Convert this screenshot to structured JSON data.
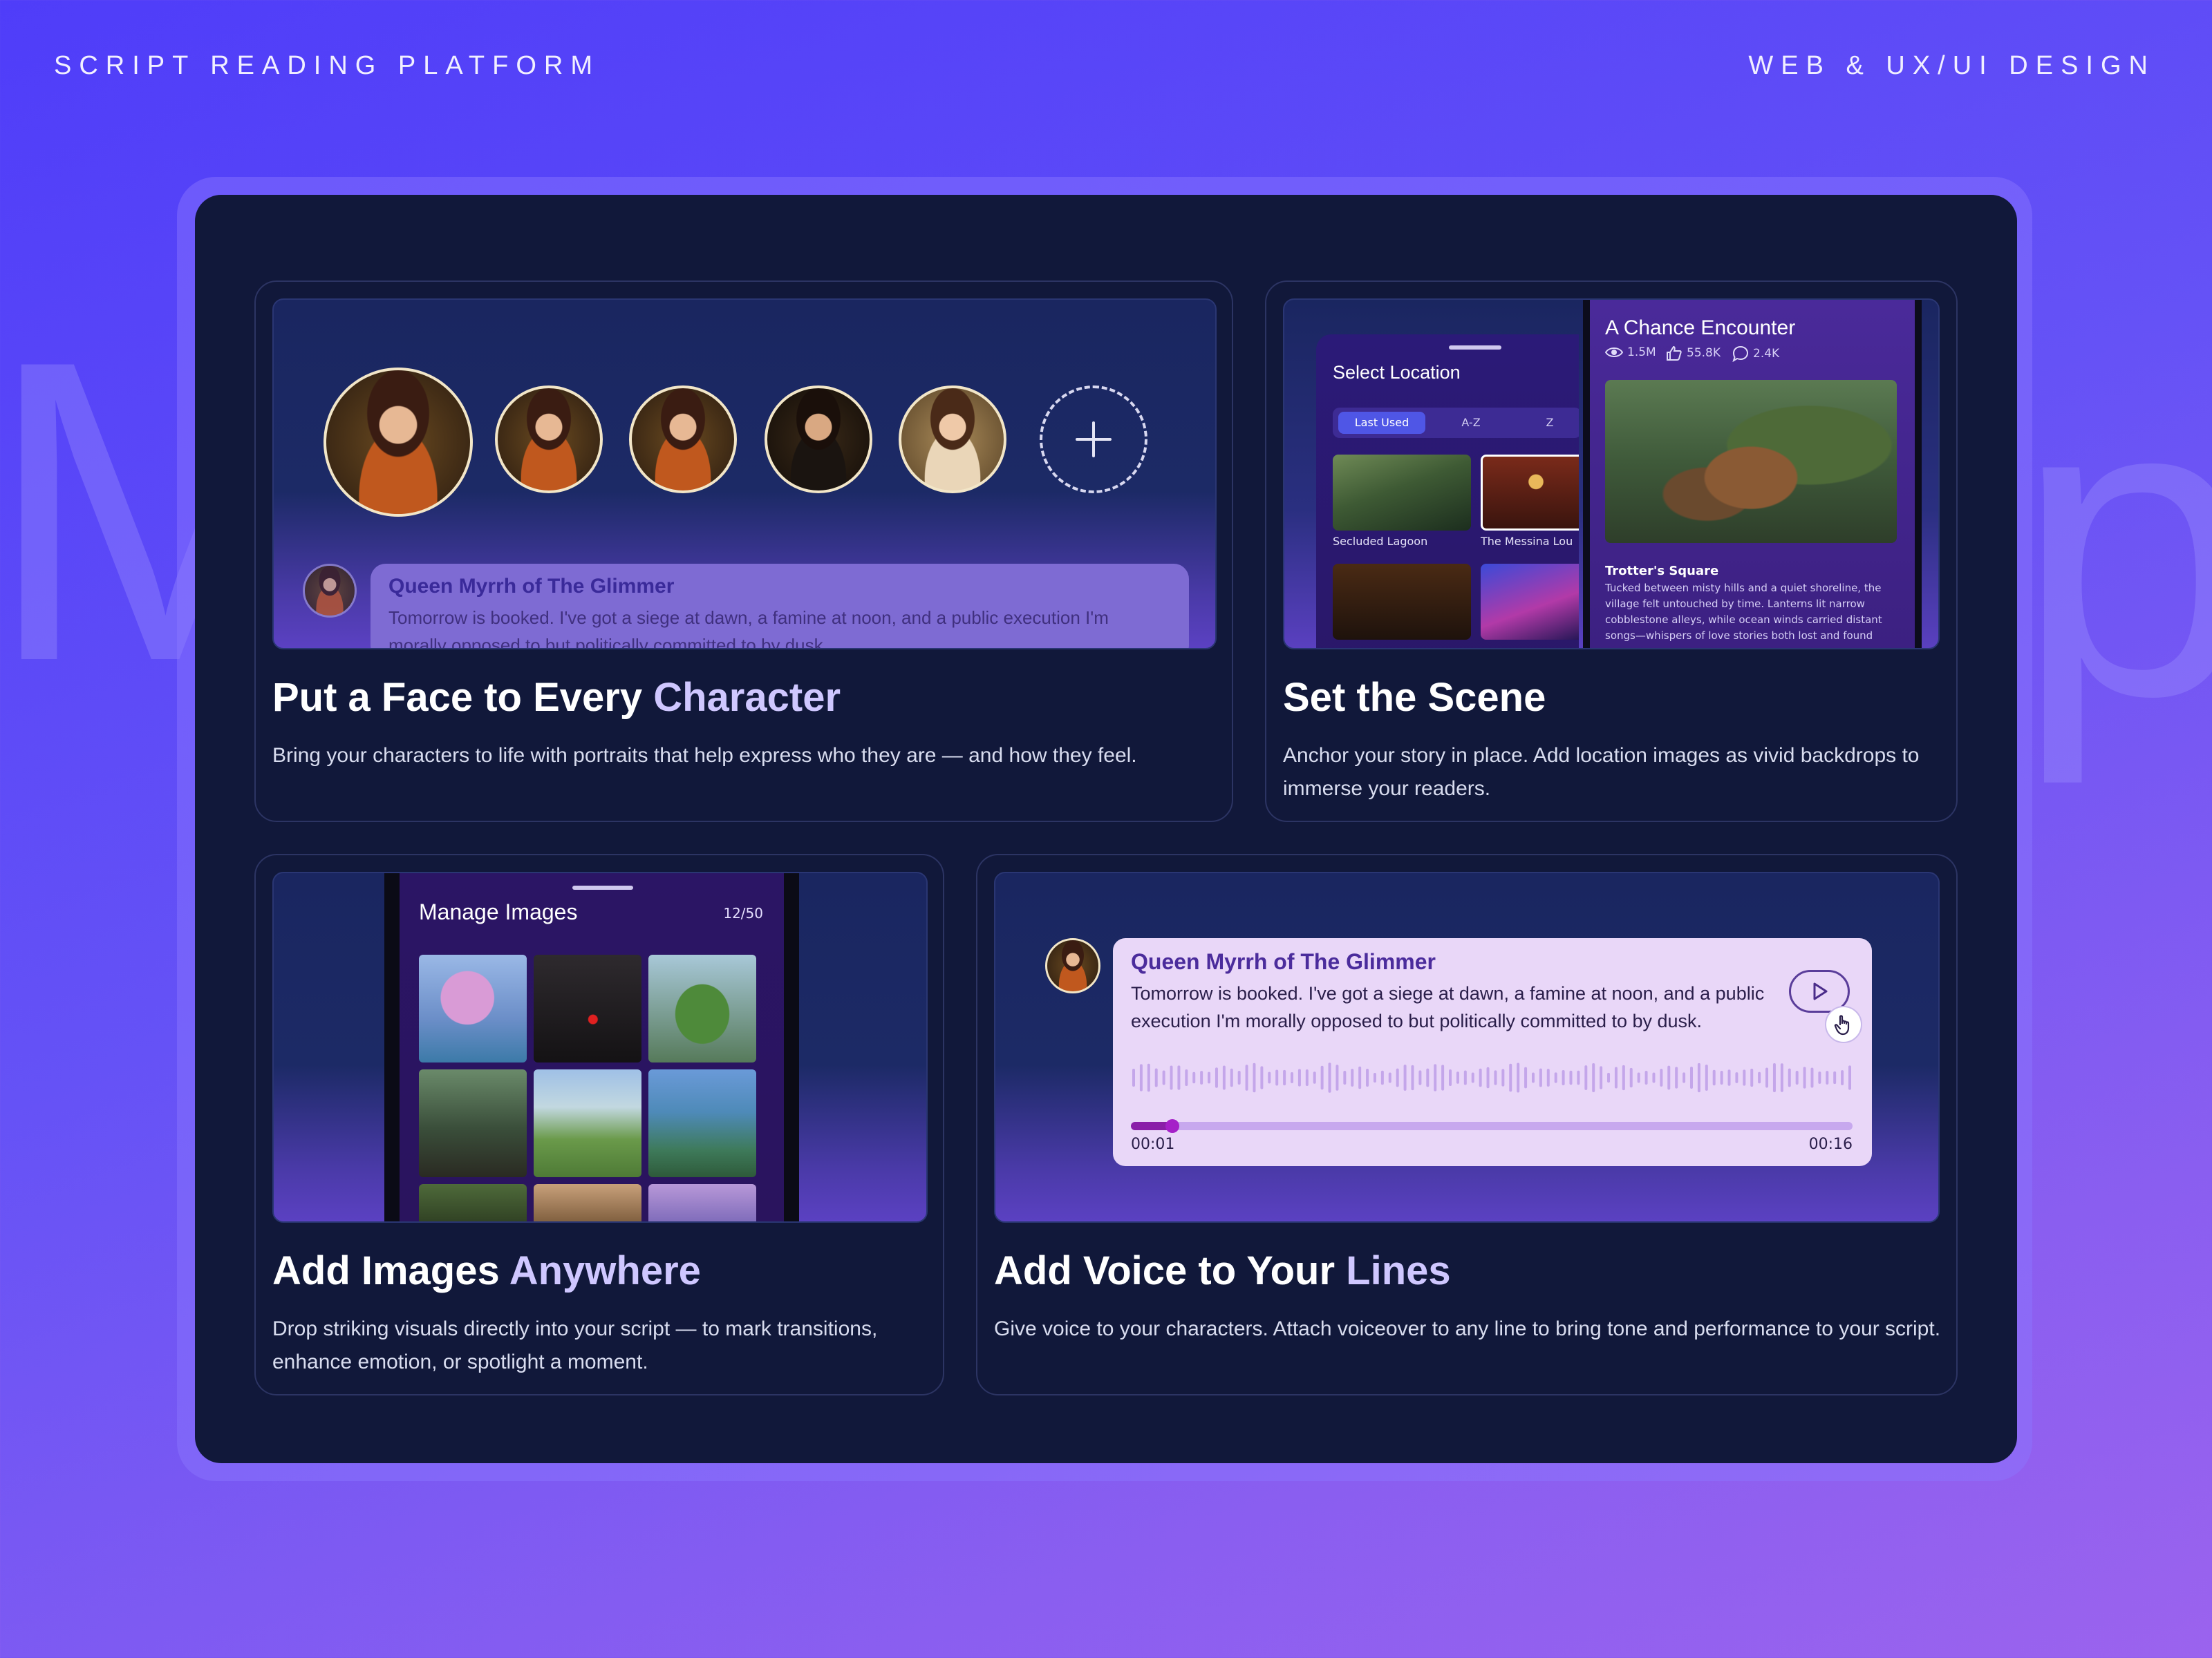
{
  "header": {
    "left_label": "SCRIPT READING PLATFORM",
    "right_label": "WEB & UX/UI DESIGN"
  },
  "watermark": {
    "left_letter": "M",
    "right_letter": "p"
  },
  "cards": {
    "character": {
      "title_main": "Put a Face to Every ",
      "title_accent": "Character",
      "description": "Bring your characters to life with portraits that help express who they are — and how they feel.",
      "speech_name": "Queen Myrrh of The Glimmer",
      "speech_text": "Tomorrow is booked. I've got a siege at dawn, a famine at noon, and a public execution I'm morally opposed to but politically committed to by dusk."
    },
    "scene": {
      "title": "Set the Scene",
      "description": "Anchor your story in place. Add location images as vivid backdrops to immerse your readers.",
      "select_title": "Select Location",
      "tabs": [
        "Last Used",
        "A-Z",
        "Z"
      ],
      "locations": [
        "Secluded Lagoon",
        "The Messina Lou"
      ],
      "encounter_title": "A Chance Encounter",
      "stats": {
        "views": "1.5M",
        "likes": "55.8K",
        "comments": "2.4K"
      },
      "place_name": "Trotter's Square",
      "place_text": "Tucked between misty hills and a quiet shoreline, the village felt untouched by time. Lanterns lit narrow cobblestone alleys, while ocean winds carried distant songs—whispers of love stories both lost and found"
    },
    "images": {
      "title_main": "Add Images ",
      "title_accent": "Anywhere",
      "description": "Drop striking visuals directly into your script — to mark transitions, enhance emotion, or spotlight a moment.",
      "manage_title": "Manage Images",
      "count": "12/50"
    },
    "voice": {
      "title_main": "Add Voice to Your ",
      "title_accent": "Lines",
      "description": "Give voice to your characters. Attach voiceover to any line to bring tone and performance to your script.",
      "speaker": "Queen Myrrh of The Glimmer",
      "line": "Tomorrow is booked. I've got a siege at dawn, a famine at noon, and a public execution I'm morally opposed to but politically committed to by dusk.",
      "time_current": "00:01",
      "time_total": "00:16",
      "progress": 0.057
    }
  },
  "colors": {
    "panel": "#11183a",
    "accent_text": "#cfc7ff",
    "voice_card": "#e9d7f8",
    "progress": "#8a1fa8"
  }
}
